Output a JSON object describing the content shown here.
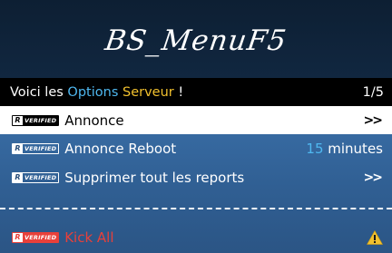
{
  "banner": {
    "title": "BS_MenuF5"
  },
  "subheader": {
    "text_prefix": "Voici les ",
    "text_blue": "Options",
    "text_space": " ",
    "text_yellow": "Serveur",
    "text_suffix": " !",
    "page_counter": "1/5"
  },
  "badge": {
    "r": "R",
    "verified": "VERIFIED"
  },
  "items": [
    {
      "label": "Annonce",
      "right": ">>",
      "selected": true
    },
    {
      "label": "Annonce Reboot",
      "right_value": "15",
      "right_unit": " minutes"
    },
    {
      "label": "Supprimer tout les reports",
      "right": ">>"
    },
    {
      "label": "Kick All",
      "right_icon": "warning-icon"
    }
  ],
  "colors": {
    "accent_blue": "#4fb8f0",
    "accent_yellow": "#f2c12e",
    "danger_red": "#e8403a",
    "menu_blue": "#3a6fa8",
    "header_dark": "#0f2238"
  }
}
